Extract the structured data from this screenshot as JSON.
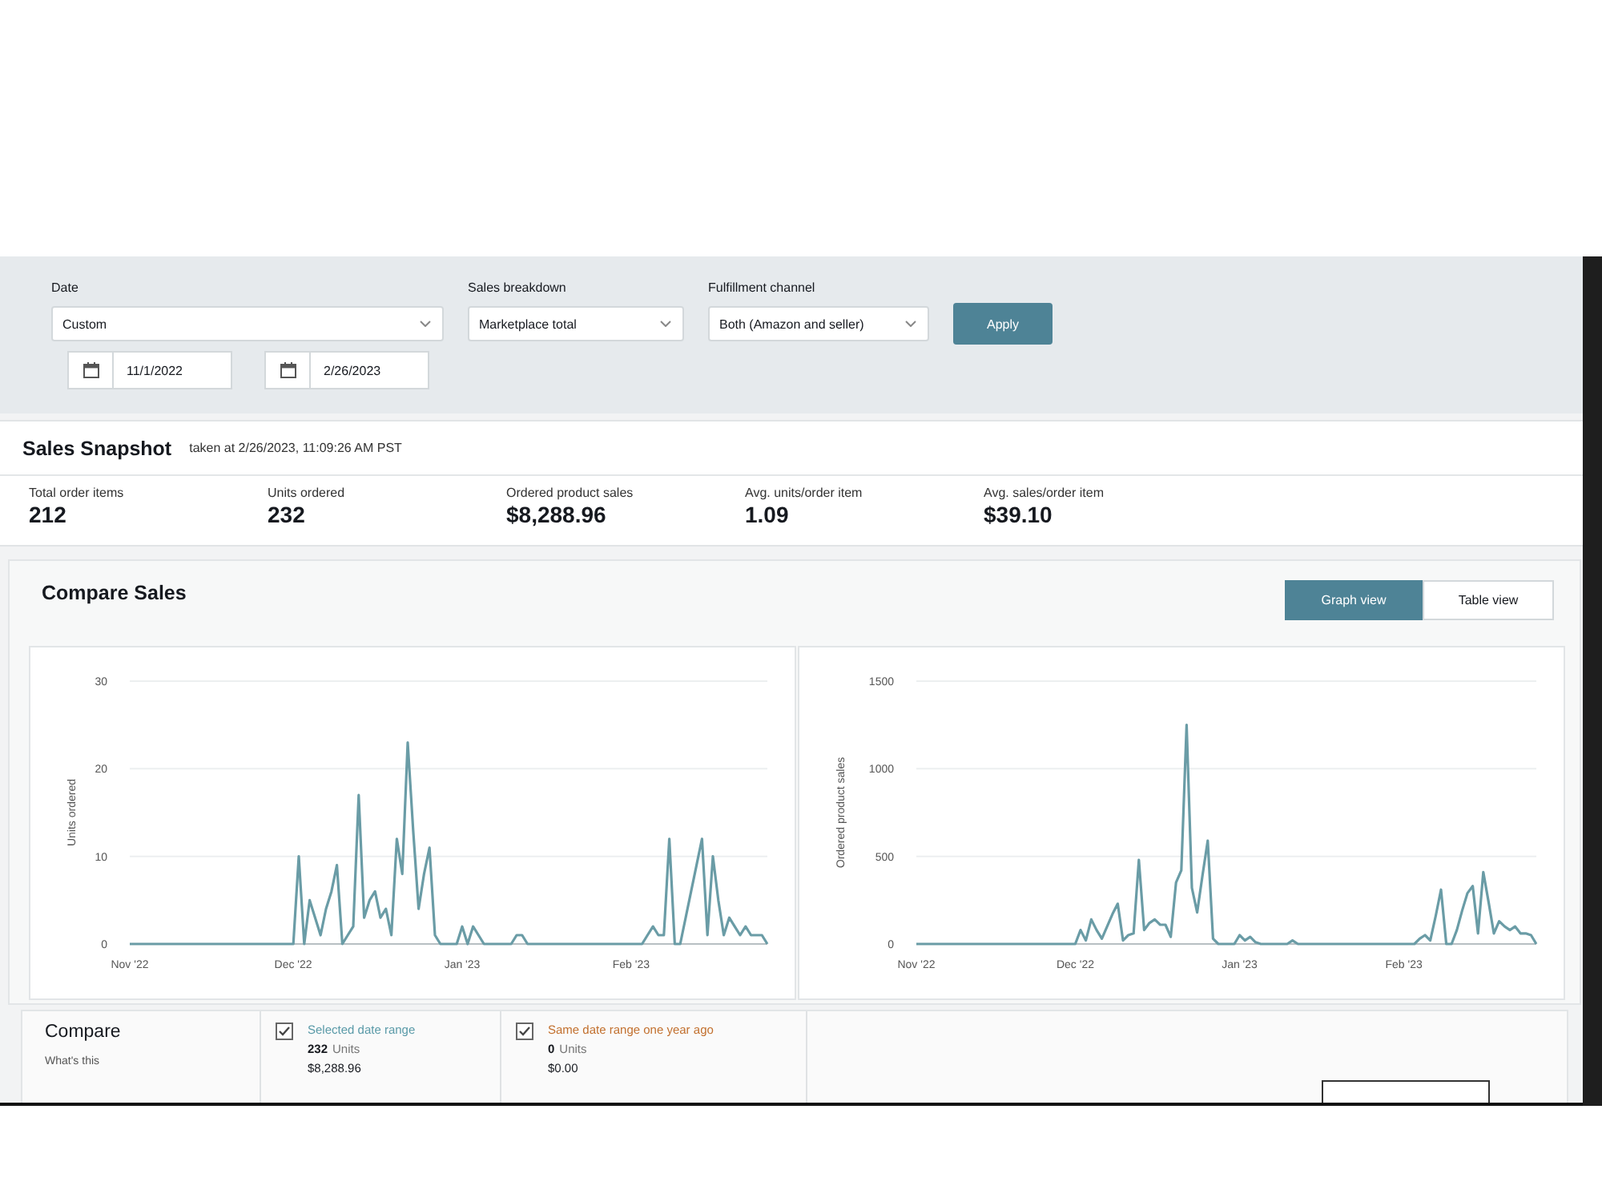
{
  "filters": {
    "date": {
      "label": "Date",
      "value": "Custom",
      "start": "11/1/2022",
      "end": "2/26/2023"
    },
    "sales_breakdown": {
      "label": "Sales breakdown",
      "value": "Marketplace total"
    },
    "fulfillment_channel": {
      "label": "Fulfillment channel",
      "value": "Both (Amazon and seller)"
    },
    "apply_button": "Apply"
  },
  "snapshot": {
    "title": "Sales Snapshot",
    "taken_at": "taken at 2/26/2023, 11:09:26 AM PST",
    "metrics": [
      {
        "label": "Total order items",
        "value": "212"
      },
      {
        "label": "Units ordered",
        "value": "232"
      },
      {
        "label": "Ordered product sales",
        "value": "$8,288.96"
      },
      {
        "label": "Avg. units/order item",
        "value": "1.09"
      },
      {
        "label": "Avg. sales/order item",
        "value": "$39.10"
      }
    ]
  },
  "compare_sales": {
    "title": "Compare Sales",
    "views": [
      {
        "label": "Graph view",
        "selected": true
      },
      {
        "label": "Table view",
        "selected": false
      }
    ],
    "charts": [
      {
        "chart_data": {
          "type": "line",
          "ylabel": "Units ordered",
          "categories": [
            "Nov '22",
            null,
            null,
            null,
            null,
            null,
            null,
            null,
            null,
            null,
            null,
            null,
            null,
            null,
            null,
            null,
            null,
            null,
            null,
            null,
            null,
            null,
            null,
            null,
            null,
            null,
            null,
            null,
            null,
            null,
            "Dec '22",
            null,
            null,
            null,
            null,
            null,
            null,
            null,
            null,
            null,
            null,
            null,
            null,
            null,
            null,
            null,
            null,
            null,
            null,
            null,
            null,
            null,
            null,
            null,
            null,
            null,
            null,
            null,
            null,
            null,
            null,
            "Jan '23",
            null,
            null,
            null,
            null,
            null,
            null,
            null,
            null,
            null,
            null,
            null,
            null,
            null,
            null,
            null,
            null,
            null,
            null,
            null,
            null,
            null,
            null,
            null,
            null,
            null,
            null,
            null,
            null,
            null,
            null,
            "Feb '23",
            null,
            null,
            null,
            null,
            null,
            null,
            null,
            null,
            null,
            null,
            null,
            null,
            null,
            null,
            null,
            null,
            null,
            null,
            null,
            null,
            null,
            null,
            null,
            null,
            null
          ],
          "series": [
            {
              "color": "#6a9ca6",
              "values": [
                0,
                0,
                0,
                0,
                0,
                0,
                0,
                0,
                0,
                0,
                0,
                0,
                0,
                0,
                0,
                0,
                0,
                0,
                0,
                0,
                0,
                0,
                0,
                0,
                0,
                0,
                0,
                0,
                0,
                0,
                0,
                10,
                0,
                5,
                3,
                1,
                4,
                6,
                9,
                0,
                1,
                2,
                17,
                3,
                5,
                6,
                3,
                4,
                1,
                12,
                8,
                23,
                13,
                4,
                8,
                11,
                1,
                0,
                0,
                0,
                0,
                2,
                0,
                2,
                1,
                0,
                0,
                0,
                0,
                0,
                0,
                1,
                1,
                0,
                0,
                0,
                0,
                0,
                0,
                0,
                0,
                0,
                0,
                0,
                0,
                0,
                0,
                0,
                0,
                0,
                0,
                0,
                0,
                0,
                0,
                1,
                2,
                1,
                1,
                12,
                0,
                0,
                3,
                6,
                9,
                12,
                1,
                10,
                5,
                1,
                3,
                2,
                1,
                2,
                1,
                1,
                1,
                0
              ]
            }
          ],
          "ylim": [
            0,
            30
          ],
          "yticks": [
            0,
            10,
            20,
            30
          ]
        }
      },
      {
        "chart_data": {
          "type": "line",
          "ylabel": "Ordered product sales",
          "categories": [
            "Nov '22",
            null,
            null,
            null,
            null,
            null,
            null,
            null,
            null,
            null,
            null,
            null,
            null,
            null,
            null,
            null,
            null,
            null,
            null,
            null,
            null,
            null,
            null,
            null,
            null,
            null,
            null,
            null,
            null,
            null,
            "Dec '22",
            null,
            null,
            null,
            null,
            null,
            null,
            null,
            null,
            null,
            null,
            null,
            null,
            null,
            null,
            null,
            null,
            null,
            null,
            null,
            null,
            null,
            null,
            null,
            null,
            null,
            null,
            null,
            null,
            null,
            null,
            "Jan '23",
            null,
            null,
            null,
            null,
            null,
            null,
            null,
            null,
            null,
            null,
            null,
            null,
            null,
            null,
            null,
            null,
            null,
            null,
            null,
            null,
            null,
            null,
            null,
            null,
            null,
            null,
            null,
            null,
            null,
            null,
            "Feb '23",
            null,
            null,
            null,
            null,
            null,
            null,
            null,
            null,
            null,
            null,
            null,
            null,
            null,
            null,
            null,
            null,
            null,
            null,
            null,
            null,
            null,
            null,
            null,
            null,
            null
          ],
          "series": [
            {
              "color": "#6a9ca6",
              "values": [
                0,
                0,
                0,
                0,
                0,
                0,
                0,
                0,
                0,
                0,
                0,
                0,
                0,
                0,
                0,
                0,
                0,
                0,
                0,
                0,
                0,
                0,
                0,
                0,
                0,
                0,
                0,
                0,
                0,
                0,
                0,
                80,
                20,
                140,
                80,
                30,
                100,
                170,
                230,
                20,
                50,
                60,
                480,
                80,
                120,
                140,
                110,
                110,
                40,
                350,
                420,
                1250,
                320,
                180,
                390,
                590,
                30,
                0,
                0,
                0,
                0,
                50,
                20,
                40,
                10,
                0,
                0,
                0,
                0,
                0,
                0,
                20,
                0,
                0,
                0,
                0,
                0,
                0,
                0,
                0,
                0,
                0,
                0,
                0,
                0,
                0,
                0,
                0,
                0,
                0,
                0,
                0,
                0,
                0,
                0,
                30,
                50,
                20,
                160,
                310,
                0,
                0,
                80,
                190,
                290,
                330,
                60,
                410,
                240,
                60,
                130,
                100,
                80,
                100,
                60,
                60,
                50,
                0
              ]
            }
          ],
          "ylim": [
            0,
            1500
          ],
          "yticks": [
            0,
            500,
            1000,
            1500
          ]
        }
      }
    ]
  },
  "compare": {
    "title": "Compare",
    "help_link": "What's this",
    "ranges": [
      {
        "label": "Selected date range",
        "color": "#5a9aa8",
        "checked": true,
        "units": "232",
        "units_label": "Units",
        "sales": "$8,288.96"
      },
      {
        "label": "Same date range one year ago",
        "color": "#c2702e",
        "checked": true,
        "units": "0",
        "units_label": "Units",
        "sales": "$0.00"
      }
    ]
  }
}
